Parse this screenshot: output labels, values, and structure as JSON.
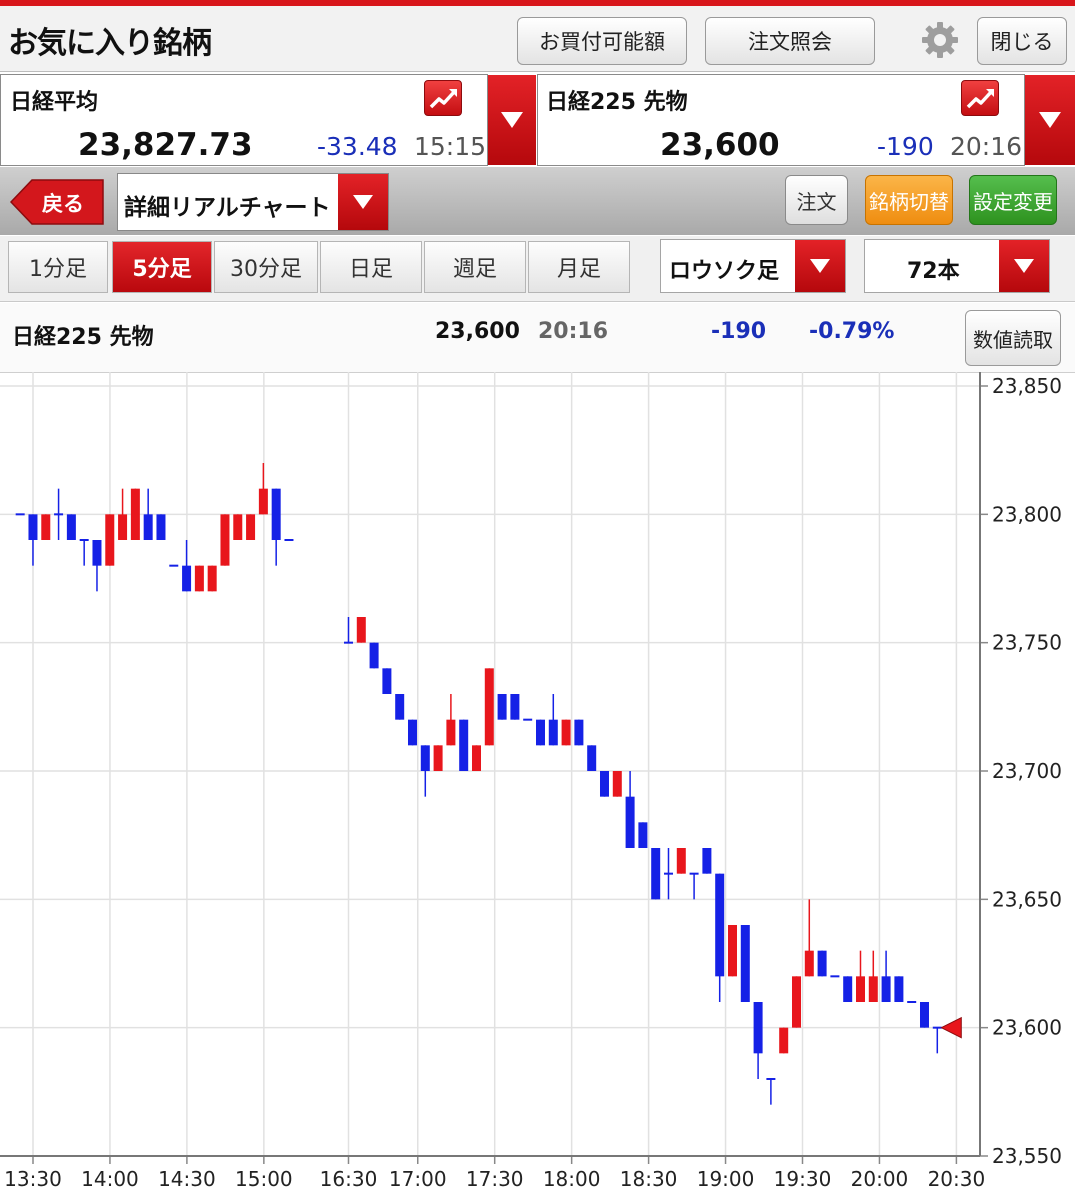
{
  "header": {
    "title": "お気に入り銘柄",
    "buying_power_button": "お買付可能額",
    "order_inquiry_button": "注文照会",
    "close_button": "閉じる"
  },
  "indices": [
    {
      "name": "日経平均",
      "price": "23,827.73",
      "change": "-33.48",
      "time": "15:15"
    },
    {
      "name": "日経225 先物",
      "price": "23,600",
      "change": "-190",
      "time": "20:16"
    }
  ],
  "toolbar": {
    "back_label": "戻る",
    "chart_type": "詳細リアルチャート",
    "order_button": "注文",
    "switch_button": "銘柄切替",
    "settings_button": "設定変更"
  },
  "periods": [
    "1分足",
    "5分足",
    "30分足",
    "日足",
    "週足",
    "月足"
  ],
  "active_period": "5分足",
  "chart_style": "ロウソク足",
  "bars_count": "72本",
  "info": {
    "name": "日経225 先物",
    "price": "23,600",
    "time": "20:16",
    "change": "-190",
    "change_pct": "-0.79%",
    "read_value_button": "数値読取"
  },
  "colors": {
    "up": "#e8161c",
    "down": "#1521e6",
    "accent": "#d8161b",
    "orange": "#f39a1e",
    "green": "#36a230"
  },
  "chart_data": {
    "type": "candlestick",
    "interval": "5min",
    "y_ticks": [
      "23,850",
      "23,800",
      "23,750",
      "23,700",
      "23,650",
      "23,600",
      "23,550"
    ],
    "ylim": [
      23550,
      23850
    ],
    "x_ticks": [
      "13:30",
      "14:00",
      "14:30",
      "15:00",
      "16:30",
      "17:00",
      "17:30",
      "18:00",
      "18:30",
      "19:00",
      "19:30",
      "20:00",
      "20:30"
    ],
    "last_price": 23600,
    "sessions": [
      {
        "start": "13:25",
        "candles": [
          {
            "o": 23800,
            "h": 23800,
            "l": 23800,
            "c": 23800
          },
          {
            "o": 23800,
            "h": 23800,
            "l": 23780,
            "c": 23790
          },
          {
            "o": 23790,
            "h": 23800,
            "l": 23790,
            "c": 23800
          },
          {
            "o": 23800,
            "h": 23810,
            "l": 23790,
            "c": 23800
          },
          {
            "o": 23800,
            "h": 23800,
            "l": 23790,
            "c": 23790
          },
          {
            "o": 23790,
            "h": 23790,
            "l": 23780,
            "c": 23790
          },
          {
            "o": 23790,
            "h": 23790,
            "l": 23770,
            "c": 23780
          },
          {
            "o": 23780,
            "h": 23800,
            "l": 23780,
            "c": 23800
          },
          {
            "o": 23790,
            "h": 23810,
            "l": 23790,
            "c": 23800
          },
          {
            "o": 23790,
            "h": 23810,
            "l": 23790,
            "c": 23810
          },
          {
            "o": 23800,
            "h": 23810,
            "l": 23790,
            "c": 23790
          },
          {
            "o": 23800,
            "h": 23800,
            "l": 23790,
            "c": 23790
          },
          {
            "o": 23780,
            "h": 23780,
            "l": 23780,
            "c": 23780
          },
          {
            "o": 23780,
            "h": 23790,
            "l": 23770,
            "c": 23770
          },
          {
            "o": 23770,
            "h": 23780,
            "l": 23770,
            "c": 23780
          },
          {
            "o": 23770,
            "h": 23780,
            "l": 23770,
            "c": 23780
          },
          {
            "o": 23780,
            "h": 23800,
            "l": 23780,
            "c": 23800
          },
          {
            "o": 23790,
            "h": 23800,
            "l": 23790,
            "c": 23800
          },
          {
            "o": 23790,
            "h": 23800,
            "l": 23790,
            "c": 23800
          },
          {
            "o": 23800,
            "h": 23820,
            "l": 23800,
            "c": 23810
          },
          {
            "o": 23810,
            "h": 23810,
            "l": 23780,
            "c": 23790
          },
          {
            "o": 23790,
            "h": 23790,
            "l": 23790,
            "c": 23790
          }
        ]
      },
      {
        "start": "16:30",
        "candles": [
          {
            "o": 23750,
            "h": 23760,
            "l": 23750,
            "c": 23750
          },
          {
            "o": 23750,
            "h": 23760,
            "l": 23750,
            "c": 23760
          },
          {
            "o": 23750,
            "h": 23750,
            "l": 23740,
            "c": 23740
          },
          {
            "o": 23740,
            "h": 23740,
            "l": 23730,
            "c": 23730
          },
          {
            "o": 23730,
            "h": 23730,
            "l": 23720,
            "c": 23720
          },
          {
            "o": 23720,
            "h": 23720,
            "l": 23710,
            "c": 23710
          },
          {
            "o": 23710,
            "h": 23710,
            "l": 23690,
            "c": 23700
          },
          {
            "o": 23700,
            "h": 23710,
            "l": 23700,
            "c": 23710
          },
          {
            "o": 23710,
            "h": 23730,
            "l": 23710,
            "c": 23720
          },
          {
            "o": 23720,
            "h": 23720,
            "l": 23700,
            "c": 23700
          },
          {
            "o": 23700,
            "h": 23710,
            "l": 23700,
            "c": 23710
          },
          {
            "o": 23710,
            "h": 23740,
            "l": 23710,
            "c": 23740
          },
          {
            "o": 23730,
            "h": 23730,
            "l": 23720,
            "c": 23720
          },
          {
            "o": 23730,
            "h": 23730,
            "l": 23720,
            "c": 23720
          },
          {
            "o": 23720,
            "h": 23720,
            "l": 23720,
            "c": 23720
          },
          {
            "o": 23720,
            "h": 23720,
            "l": 23710,
            "c": 23710
          },
          {
            "o": 23720,
            "h": 23730,
            "l": 23710,
            "c": 23710
          },
          {
            "o": 23710,
            "h": 23720,
            "l": 23710,
            "c": 23720
          },
          {
            "o": 23720,
            "h": 23720,
            "l": 23710,
            "c": 23710
          },
          {
            "o": 23710,
            "h": 23710,
            "l": 23700,
            "c": 23700
          },
          {
            "o": 23700,
            "h": 23700,
            "l": 23690,
            "c": 23690
          },
          {
            "o": 23690,
            "h": 23700,
            "l": 23690,
            "c": 23700
          },
          {
            "o": 23690,
            "h": 23700,
            "l": 23670,
            "c": 23670
          },
          {
            "o": 23680,
            "h": 23680,
            "l": 23670,
            "c": 23670
          },
          {
            "o": 23670,
            "h": 23670,
            "l": 23650,
            "c": 23650
          },
          {
            "o": 23660,
            "h": 23670,
            "l": 23650,
            "c": 23660
          },
          {
            "o": 23660,
            "h": 23670,
            "l": 23660,
            "c": 23670
          },
          {
            "o": 23660,
            "h": 23660,
            "l": 23650,
            "c": 23660
          },
          {
            "o": 23670,
            "h": 23670,
            "l": 23660,
            "c": 23660
          },
          {
            "o": 23660,
            "h": 23660,
            "l": 23610,
            "c": 23620
          },
          {
            "o": 23620,
            "h": 23640,
            "l": 23620,
            "c": 23640
          },
          {
            "o": 23640,
            "h": 23640,
            "l": 23610,
            "c": 23610
          },
          {
            "o": 23610,
            "h": 23610,
            "l": 23580,
            "c": 23590
          },
          {
            "o": 23580,
            "h": 23580,
            "l": 23570,
            "c": 23580
          },
          {
            "o": 23590,
            "h": 23600,
            "l": 23590,
            "c": 23600
          },
          {
            "o": 23600,
            "h": 23620,
            "l": 23600,
            "c": 23620
          },
          {
            "o": 23620,
            "h": 23650,
            "l": 23620,
            "c": 23630
          },
          {
            "o": 23630,
            "h": 23630,
            "l": 23620,
            "c": 23620
          },
          {
            "o": 23620,
            "h": 23620,
            "l": 23620,
            "c": 23620
          },
          {
            "o": 23620,
            "h": 23620,
            "l": 23610,
            "c": 23610
          },
          {
            "o": 23610,
            "h": 23630,
            "l": 23610,
            "c": 23620
          },
          {
            "o": 23610,
            "h": 23630,
            "l": 23610,
            "c": 23620
          },
          {
            "o": 23620,
            "h": 23630,
            "l": 23610,
            "c": 23610
          },
          {
            "o": 23620,
            "h": 23620,
            "l": 23610,
            "c": 23610
          },
          {
            "o": 23610,
            "h": 23610,
            "l": 23610,
            "c": 23610
          },
          {
            "o": 23610,
            "h": 23610,
            "l": 23600,
            "c": 23600
          },
          {
            "o": 23600,
            "h": 23600,
            "l": 23590,
            "c": 23600
          }
        ]
      }
    ]
  }
}
